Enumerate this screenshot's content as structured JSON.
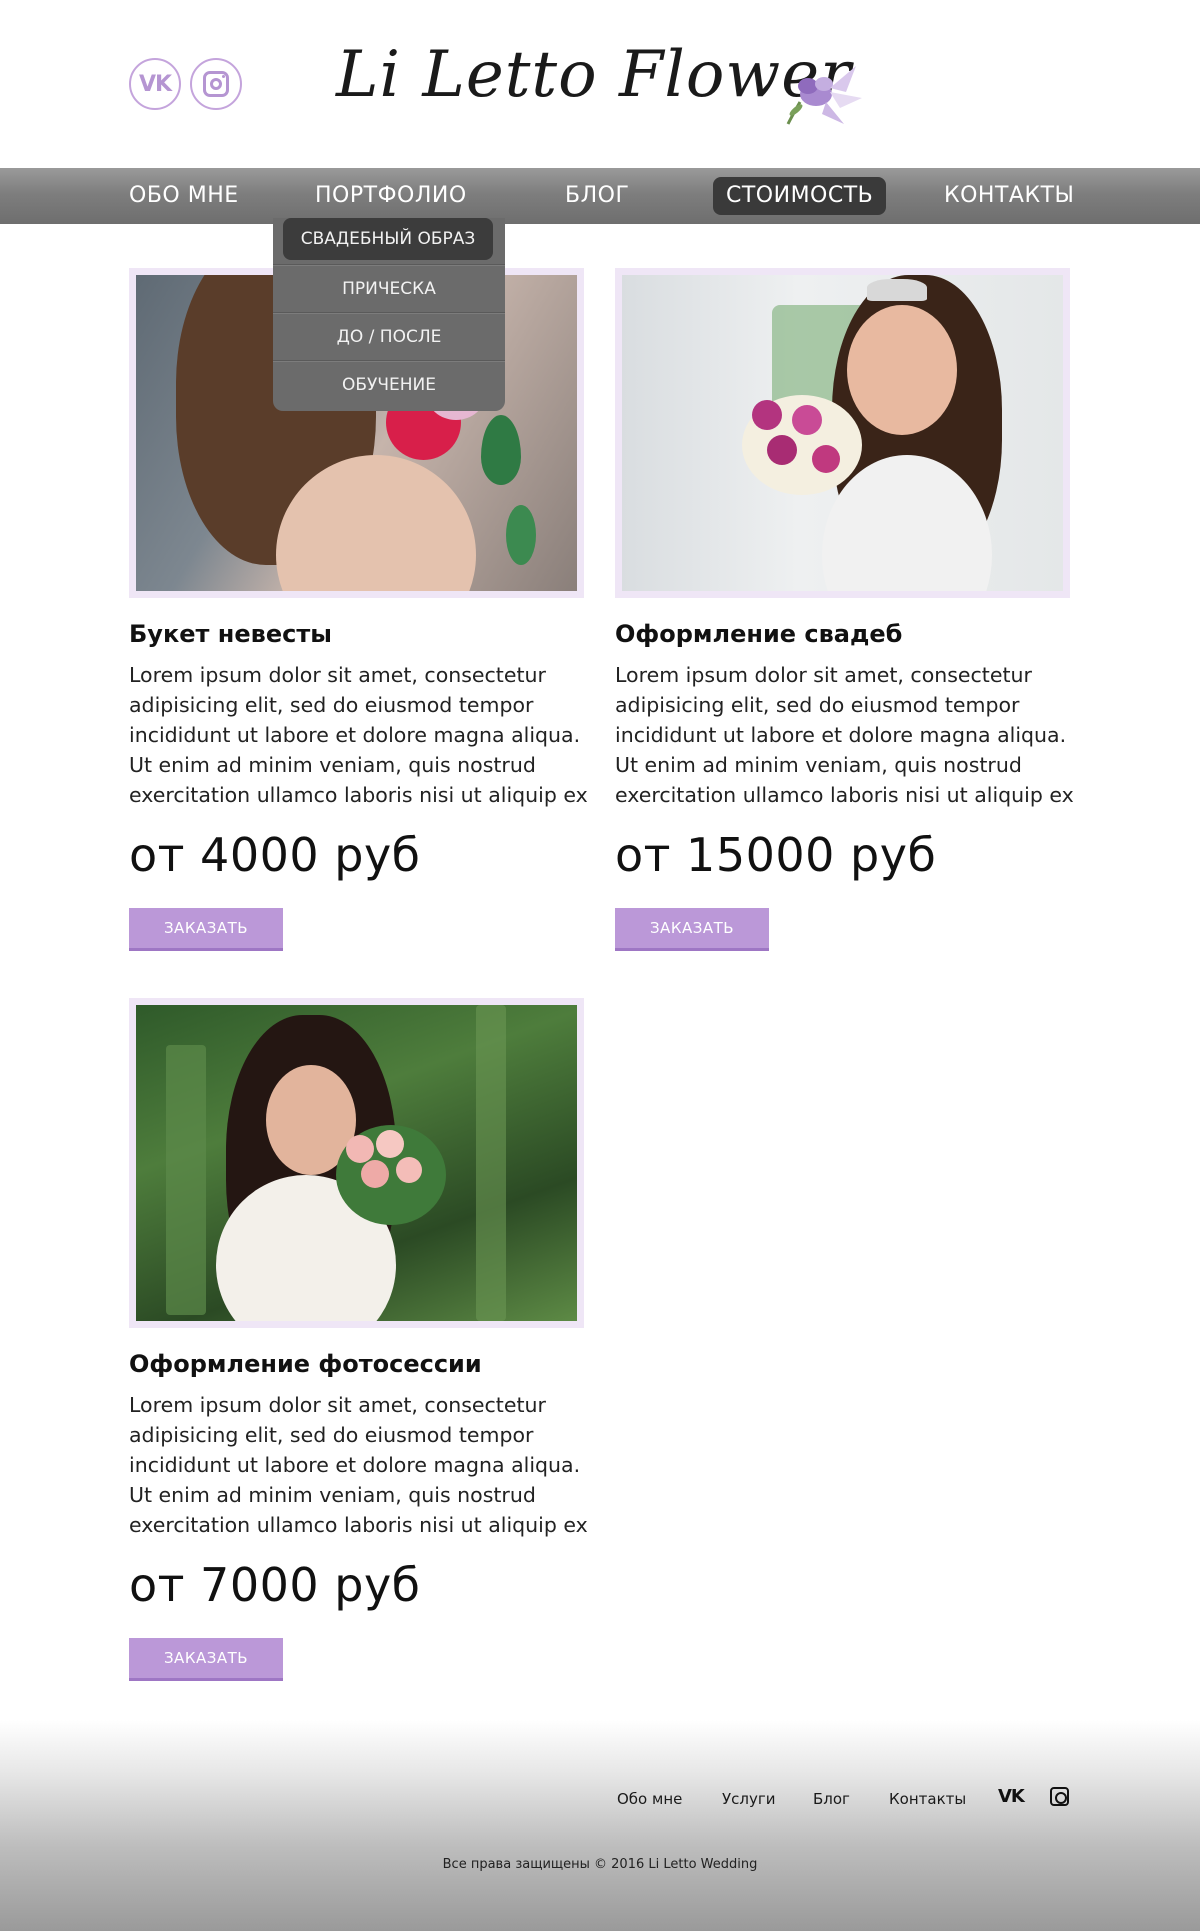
{
  "header": {
    "logo_text": "Li Letto Flower",
    "social": [
      {
        "icon": "vk-icon",
        "label": "VK"
      },
      {
        "icon": "instagram-icon"
      }
    ]
  },
  "nav": {
    "items": [
      {
        "label": "ОБО МНЕ"
      },
      {
        "label": "ПОРТФОЛИО"
      },
      {
        "label": "БЛОГ"
      },
      {
        "label": "СТОИМОСТЬ",
        "active": true
      },
      {
        "label": "КОНТАКТЫ"
      }
    ],
    "dropdown": [
      {
        "label": "СВАДЕБНЫЙ ОБРАЗ",
        "active": true
      },
      {
        "label": "ПРИЧЕСКА"
      },
      {
        "label": "ДО / ПОСЛЕ"
      },
      {
        "label": "ОБУЧЕНИЕ"
      }
    ]
  },
  "cards": [
    {
      "title": "Букет невесты",
      "desc": [
        "Lorem ipsum dolor sit amet, consectetur",
        "adipisicing elit, sed do eiusmod tempor",
        "incididunt ut labore et dolore magna aliqua.",
        "Ut enim ad minim veniam, quis nostrud",
        "exercitation ullamco laboris nisi ut aliquip ex"
      ],
      "price": "от 4000 руб",
      "button": "ЗАКАЗАТЬ"
    },
    {
      "title": "Оформление свадеб",
      "desc": [
        "Lorem ipsum dolor sit amet, consectetur",
        "adipisicing elit, sed do eiusmod tempor",
        "incididunt ut labore et dolore magna aliqua.",
        "Ut enim ad minim veniam, quis nostrud",
        "exercitation ullamco laboris nisi ut aliquip ex"
      ],
      "price": "от 15000 руб",
      "button": "ЗАКАЗАТЬ"
    },
    {
      "title": "Оформление фотосессии",
      "desc": [
        "Lorem ipsum dolor sit amet, consectetur",
        "adipisicing elit, sed do eiusmod tempor",
        "incididunt ut labore et dolore magna aliqua.",
        "Ut enim ad minim veniam, quis nostrud",
        "exercitation ullamco laboris nisi ut aliquip ex"
      ],
      "price": "от 7000 руб",
      "button": "ЗАКАЗАТЬ"
    }
  ],
  "footer": {
    "links": [
      "Обо мне",
      "Услуги",
      "Блог",
      "Контакты"
    ],
    "vk_label": "VK",
    "copyright": "Все права защищены © 2016 Li Letto Wedding"
  },
  "colors": {
    "accent": "#bb98d8",
    "nav_bg": "#7e7e7e",
    "active_bg": "#3a3a3a",
    "frame": "#efe6f6"
  }
}
